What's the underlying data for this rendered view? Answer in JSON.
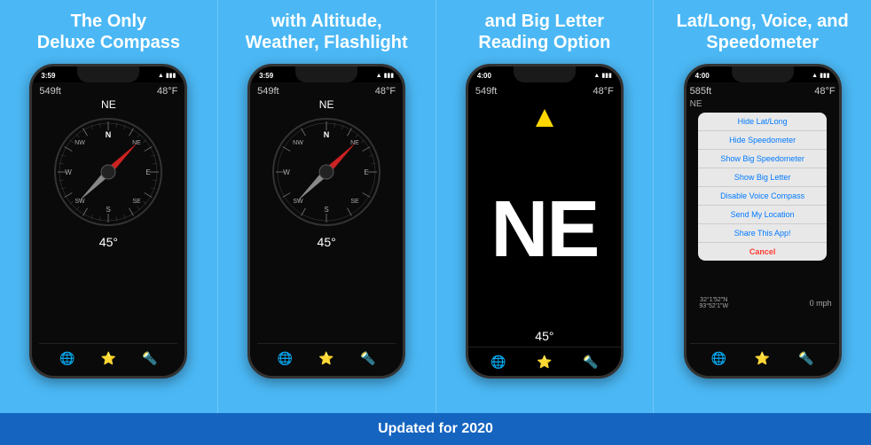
{
  "panels": [
    {
      "id": "panel1",
      "title": "The Only\nDeluxe Compass",
      "phone": {
        "statusTime": "3:59",
        "altitude": "549ft",
        "temperature": "48°F",
        "direction": "NE",
        "degrees": "45°",
        "showCompass": true,
        "showMenu": false,
        "showBigLetter": false
      }
    },
    {
      "id": "panel2",
      "title": "with Altitude,\nWeather, Flashlight",
      "phone": {
        "statusTime": "3:59",
        "altitude": "549ft",
        "temperature": "48°F",
        "direction": "NE",
        "degrees": "45°",
        "showCompass": true,
        "showMenu": false,
        "showBigLetter": false
      }
    },
    {
      "id": "panel3",
      "title": "and Big Letter\nReading Option",
      "phone": {
        "statusTime": "4:00",
        "altitude": "549ft",
        "temperature": "48°F",
        "direction": "NE",
        "degrees": "45°",
        "showCompass": false,
        "showMenu": false,
        "showBigLetter": true
      }
    },
    {
      "id": "panel4",
      "title": "Lat/Long, Voice, and\nSpeedometer",
      "phone": {
        "statusTime": "4:00",
        "altitude": "585ft",
        "temperature": "48°F",
        "direction": "NE",
        "degrees": "",
        "coords": "32°1'52\"N 93°52'1\"W",
        "speed": "0 mph",
        "showCompass": false,
        "showMenu": true,
        "showBigLetter": false,
        "menuItems": [
          "Hide Lat/Long",
          "Hide Speedometer",
          "Show Big Speedometer",
          "Show Big Letter",
          "Disable Voice Compass",
          "Send My Location",
          "Share This App!",
          "Cancel"
        ]
      }
    }
  ],
  "bottomBanner": {
    "text": "Updated for 2020",
    "bgColor": "#1565C0"
  },
  "icons": {
    "globe": "🌐",
    "star": "⭐",
    "flashlight": "🔦",
    "wifi": "▲",
    "battery": "▮"
  }
}
